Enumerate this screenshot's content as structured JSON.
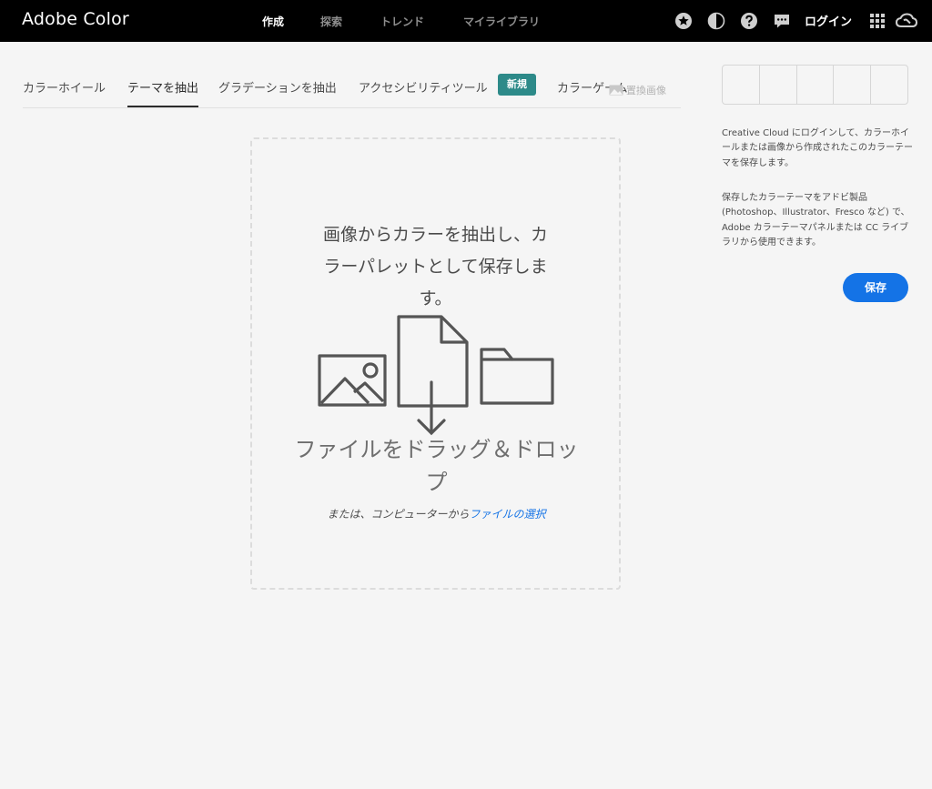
{
  "header": {
    "brand": "Adobe Color",
    "nav": [
      "作成",
      "探索",
      "トレンド",
      "マイライブラリ"
    ],
    "active_nav": "作成",
    "icons": [
      "star-icon",
      "contrast-icon",
      "help-icon",
      "feedback-icon",
      "apps-grid-icon",
      "creative-cloud-icon"
    ],
    "login_label": "ログイン"
  },
  "tabs": {
    "items": [
      "カラーホイール",
      "テーマを抽出",
      "グラデーションを抽出",
      "アクセシビリティツール",
      "カラーゲーム"
    ],
    "active": "テーマを抽出",
    "new_badge": "新規",
    "replace_image_label": "置換画像"
  },
  "dropzone": {
    "headline": "画像からカラーを抽出し、カラーパレットとして保存します。",
    "drag_text": "ファイルをドラッグ＆ドロップ",
    "sub_text": "または、コンピューターから",
    "sub_link": "ファイルの選択"
  },
  "panel": {
    "swatch_count": 5,
    "text1": "Creative Cloud にログインして、カラーホイールまたは画像から作成されたこのカラーテーマを保存します。",
    "text2": "保存したカラーテーマをアドビ製品 (Photoshop、Illustrator、Fresco など) で、Adobe カラーテーマパネルまたは CC ライブラリから使用できます。",
    "save_label": "保存"
  },
  "colors": {
    "topbar": "#000000",
    "background": "#f5f5f5",
    "accent_blue": "#1473e6",
    "badge_teal": "#2d8a89"
  }
}
